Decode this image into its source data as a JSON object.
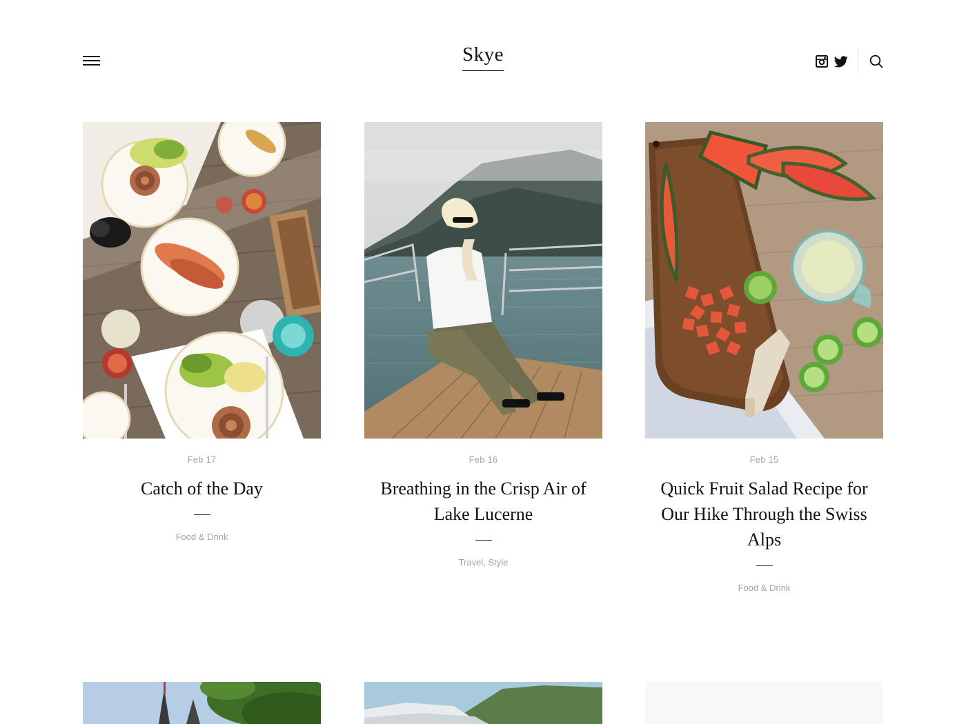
{
  "site": {
    "logo": "Skye"
  },
  "header": {
    "menu_icon": "hamburger-icon",
    "social": [
      {
        "name": "instagram",
        "icon": "instagram-icon"
      },
      {
        "name": "twitter",
        "icon": "twitter-icon"
      }
    ],
    "search_icon": "search-icon"
  },
  "posts": [
    {
      "date": "Feb 17",
      "title": "Catch of the Day",
      "categories": [
        "Food & Drink"
      ]
    },
    {
      "date": "Feb 16",
      "title": "Breathing in the Crisp Air of Lake Lucerne",
      "categories": [
        "Travel",
        "Style"
      ]
    },
    {
      "date": "Feb 15",
      "title": "Quick Fruit Salad Recipe for Our Hike Through the Swiss Alps",
      "categories": [
        "Food & Drink"
      ]
    }
  ],
  "colors": {
    "text": "#111111",
    "meta": "#a3a3a3",
    "divider": "#e2e2e2"
  }
}
